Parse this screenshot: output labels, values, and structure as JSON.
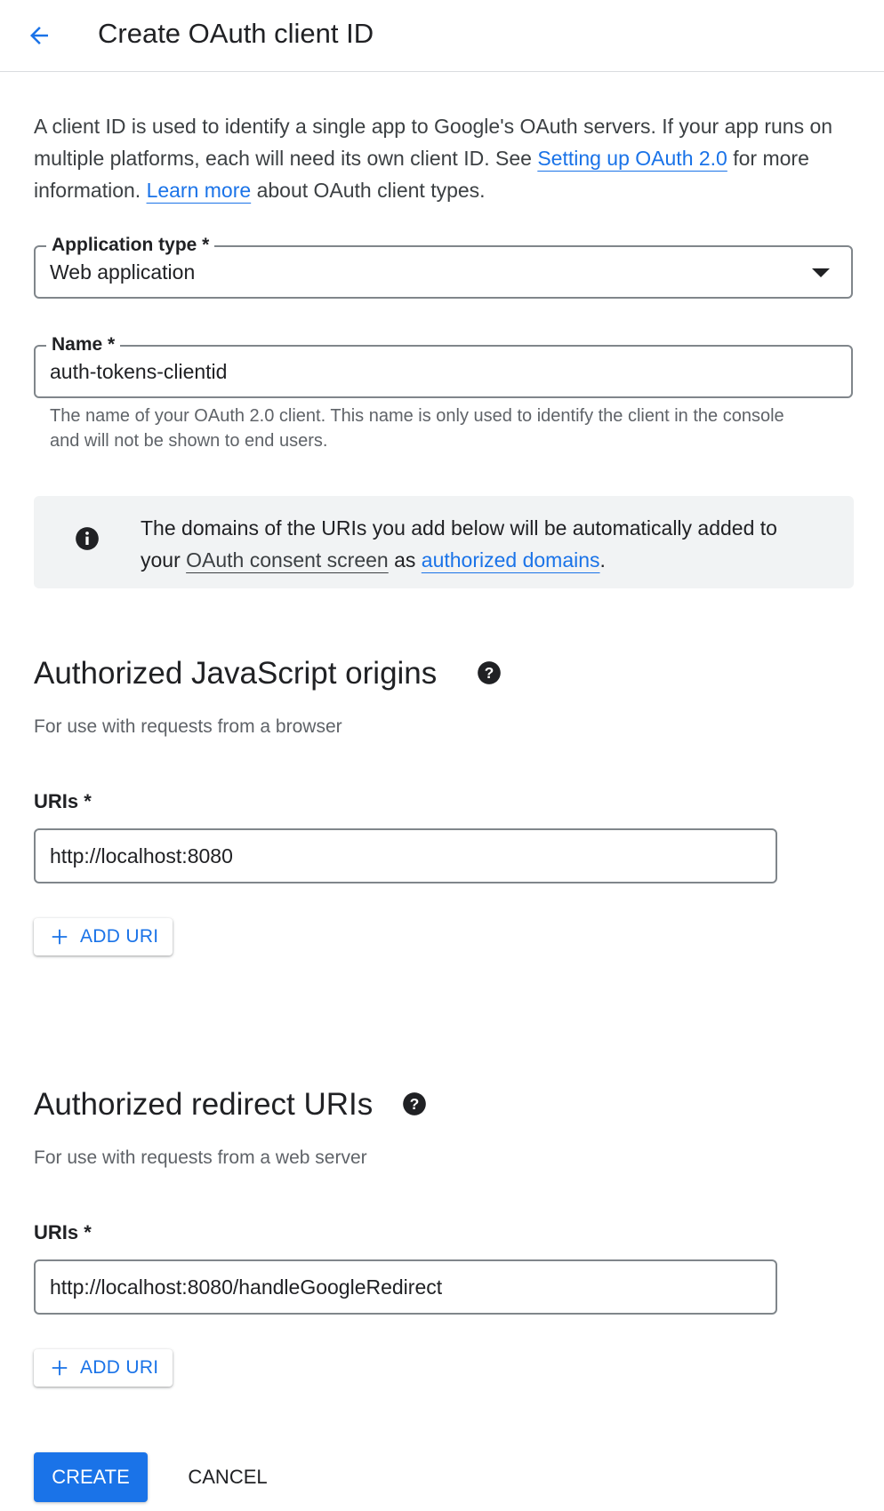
{
  "header": {
    "title": "Create OAuth client ID",
    "back_icon": "arrow-back-icon"
  },
  "intro": {
    "text1": "A client ID is used to identify a single app to Google's OAuth servers. If your app runs on multiple platforms, each will need its own client ID. See ",
    "link1": "Setting up OAuth 2.0",
    "text2": " for more information. ",
    "link2": "Learn more",
    "text3": " about OAuth client types."
  },
  "application_type": {
    "label": "Application type *",
    "value": "Web application"
  },
  "name_field": {
    "label": "Name *",
    "value": "auth-tokens-clientid",
    "helper": "The name of your OAuth 2.0 client. This name is only used to identify the client in the console and will not be shown to end users."
  },
  "info": {
    "text1": "The domains of the URIs you add below will be automatically added to your ",
    "link1": "OAuth consent screen",
    "text2": " as ",
    "link2": "authorized domains",
    "text3": "."
  },
  "js_origins": {
    "title": "Authorized JavaScript origins",
    "subtitle": "For use with requests from a browser",
    "uris_label": "URIs *",
    "uri_value": "http://localhost:8080",
    "add_label": "ADD URI"
  },
  "redirect_uris": {
    "title": "Authorized redirect URIs",
    "subtitle": "For use with requests from a web server",
    "uris_label": "URIs *",
    "uri_value": "http://localhost:8080/handleGoogleRedirect",
    "add_label": "ADD URI"
  },
  "actions": {
    "create": "CREATE",
    "cancel": "CANCEL"
  },
  "colors": {
    "accent": "#1a73e8",
    "text": "#202124",
    "muted": "#5f6368",
    "info_bg": "#f1f3f4"
  }
}
